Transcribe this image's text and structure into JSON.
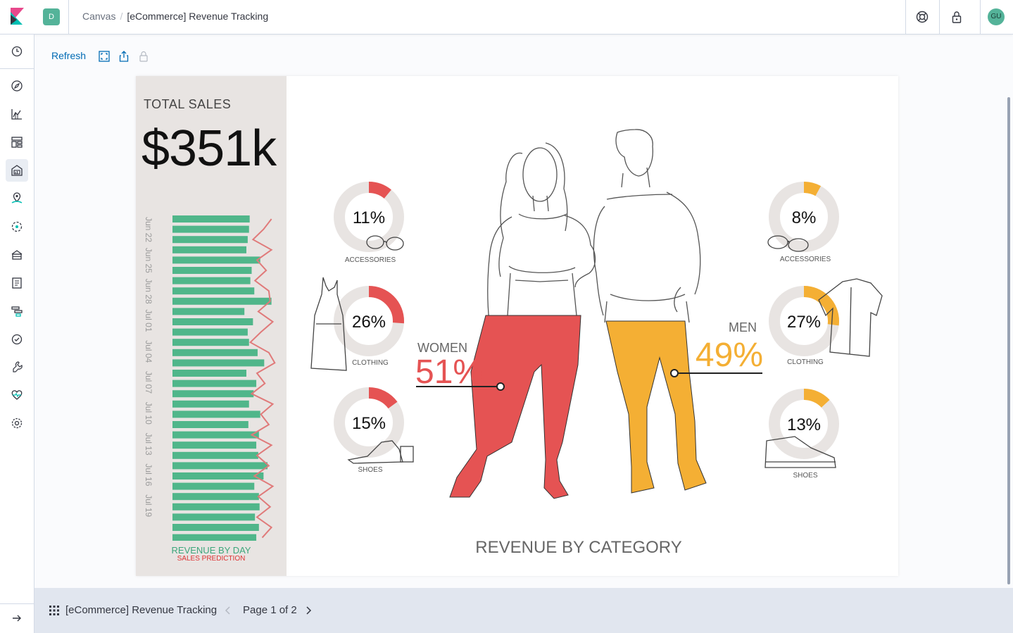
{
  "app": {
    "breadcrumb_root": "Canvas",
    "breadcrumb_current": "[eCommerce] Revenue Tracking",
    "space_initial": "D",
    "user_initials": "GU"
  },
  "toolbar": {
    "refresh_label": "Refresh"
  },
  "workpad": {
    "total_label": "TOTAL SALES",
    "total_value": "$351k",
    "revenue_by_day_label": "REVENUE BY DAY",
    "sales_prediction_label": "SALES PREDICTION",
    "revenue_by_category_label": "REVENUE BY CATEGORY",
    "women": {
      "label": "WOMEN",
      "percent": "51%"
    },
    "men": {
      "label": "MEN",
      "percent": "49%"
    },
    "women_donuts": [
      {
        "percent_text": "11%",
        "label": "ACCESSORIES",
        "value": 11
      },
      {
        "percent_text": "26%",
        "label": "CLOTHING",
        "value": 26
      },
      {
        "percent_text": "15%",
        "label": "SHOES",
        "value": 15
      }
    ],
    "men_donuts": [
      {
        "percent_text": "8%",
        "label": "ACCESSORIES",
        "value": 8
      },
      {
        "percent_text": "27%",
        "label": "CLOTHING",
        "value": 27
      },
      {
        "percent_text": "13%",
        "label": "SHOES",
        "value": 13
      }
    ]
  },
  "chart_data": {
    "type": "bar",
    "orientation": "horizontal",
    "categories": [
      "Jun 22",
      "",
      "",
      "Jun 25",
      "",
      "",
      "Jun 28",
      "",
      "",
      "Jul 01",
      "",
      "",
      "Jul 04",
      "",
      "",
      "Jul 07",
      "",
      "",
      "Jul 10",
      "",
      "",
      "Jul 13",
      "",
      "",
      "Jul 16",
      "",
      "",
      "Jul 19",
      "",
      "",
      "",
      ""
    ],
    "tick_labels": [
      "Jun 22",
      "Jun 25",
      "Jun 28",
      "Jul 01",
      "Jul 04",
      "Jul 07",
      "Jul 10",
      "Jul 13",
      "Jul 16",
      "Jul 19"
    ],
    "series": [
      {
        "name": "REVENUE BY DAY",
        "values": [
          117,
          116,
          114,
          112,
          133,
          120,
          118,
          124,
          150,
          109,
          122,
          114,
          116,
          129,
          139,
          112,
          127,
          123,
          116,
          133,
          115,
          131,
          127,
          130,
          144,
          138,
          124,
          131,
          132,
          125,
          131,
          127
        ]
      },
      {
        "name": "SALES PREDICTION",
        "values": [
          150,
          138,
          122,
          150,
          128,
          142,
          125,
          146,
          148,
          130,
          152,
          134,
          118,
          146,
          155,
          128,
          140,
          120,
          152,
          134,
          146,
          120,
          150,
          128,
          146,
          124,
          152,
          130,
          148,
          128,
          150,
          136
        ]
      }
    ],
    "xlim": [
      0,
      160
    ],
    "grid": false,
    "legend": "bottom",
    "colors": {
      "bars": "#50b68a",
      "prediction": "#e07a7a"
    }
  },
  "colors": {
    "women": "#e55353",
    "men": "#f4af34",
    "donut_track": "#e8e4e2",
    "accent": "#006bb4"
  },
  "footer": {
    "workpad_title": "[eCommerce] Revenue Tracking",
    "page_info": "Page 1 of 2"
  }
}
